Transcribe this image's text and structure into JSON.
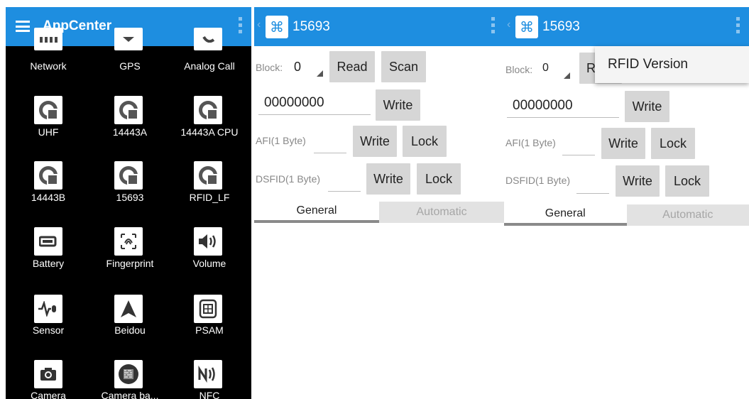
{
  "colors": {
    "actionbar": "#1e8ee0",
    "launcher_bg": "#000000",
    "button": "#d6d6d6",
    "tab_inactive": "#e2e2e2"
  },
  "screen1": {
    "title": "AppCenter",
    "apps": [
      {
        "label": "Network",
        "icon": "network-icon"
      },
      {
        "label": "GPS",
        "icon": "gps-icon"
      },
      {
        "label": "Analog Call",
        "icon": "phone-icon"
      },
      {
        "label": "UHF",
        "icon": "rfid-icon"
      },
      {
        "label": "14443A",
        "icon": "rfid-icon"
      },
      {
        "label": "14443A CPU",
        "icon": "rfid-icon"
      },
      {
        "label": "14443B",
        "icon": "rfid-icon"
      },
      {
        "label": "15693",
        "icon": "rfid-icon"
      },
      {
        "label": "RFID_LF",
        "icon": "rfid-icon"
      },
      {
        "label": "Battery",
        "icon": "battery-icon"
      },
      {
        "label": "Fingerprint",
        "icon": "fingerprint-icon"
      },
      {
        "label": "Volume",
        "icon": "volume-icon"
      },
      {
        "label": "Sensor",
        "icon": "sensor-icon"
      },
      {
        "label": "Beidou",
        "icon": "beidou-icon"
      },
      {
        "label": "PSAM",
        "icon": "psam-icon"
      },
      {
        "label": "Camera",
        "icon": "camera-icon"
      },
      {
        "label": "Camera ba...",
        "icon": "barcode-camera-icon"
      },
      {
        "label": "NFC",
        "icon": "nfc-icon"
      }
    ]
  },
  "screen2": {
    "title": "15693",
    "block_label": "Block:",
    "block_value": "0",
    "read_label": "Read",
    "scan_label": "Scan",
    "data_value": "00000000",
    "write_label": "Write",
    "afi_label": "AFI(1 Byte)",
    "afi_write_label": "Write",
    "afi_lock_label": "Lock",
    "dsfid_label": "DSFID(1 Byte)",
    "dsfid_write_label": "Write",
    "dsfid_lock_label": "Lock",
    "tab_general": "General",
    "tab_automatic": "Automatic"
  },
  "screen3": {
    "title": "15693",
    "block_label": "Block:",
    "block_value": "0",
    "read_label_partial": "R",
    "data_value": "00000000",
    "write_label": "Write",
    "afi_label": "AFI(1 Byte)",
    "afi_write_label": "Write",
    "afi_lock_label": "Lock",
    "dsfid_label": "DSFID(1 Byte)",
    "dsfid_write_label": "Write",
    "dsfid_lock_label": "Lock",
    "tab_general": "General",
    "tab_automatic": "Automatic",
    "menu_item": "RFID Version"
  }
}
